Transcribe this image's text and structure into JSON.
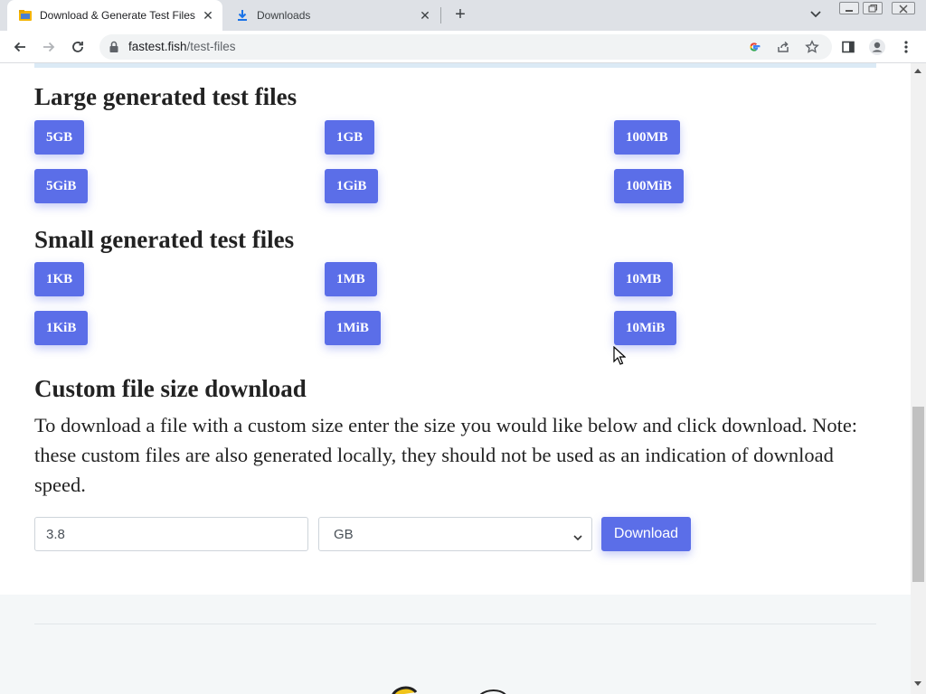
{
  "browser": {
    "tabs": [
      {
        "title": "Download & Generate Test Files",
        "active": true,
        "favicon": "folder-icon"
      },
      {
        "title": "Downloads",
        "active": false,
        "favicon": "download-icon"
      }
    ],
    "url_host": "fastest.fish",
    "url_path": "/test-files"
  },
  "page": {
    "large": {
      "heading": "Large generated test files",
      "buttons": [
        "5GB",
        "1GB",
        "100MB",
        "5GiB",
        "1GiB",
        "100MiB"
      ]
    },
    "small": {
      "heading": "Small generated test files",
      "buttons": [
        "1KB",
        "1MB",
        "10MB",
        "1KiB",
        "1MiB",
        "10MiB"
      ]
    },
    "custom": {
      "heading": "Custom file size download",
      "description": "To download a file with a custom size enter the size you would like below and click download. Note: these custom files are also generated locally, they should not be used as an indication of download speed.",
      "size_value": "3.8",
      "unit_value": "GB",
      "download_label": "Download"
    }
  },
  "colors": {
    "button": "#5b6ee8",
    "tabstrip": "#dee1e6",
    "footer": "#f4f7f8"
  }
}
